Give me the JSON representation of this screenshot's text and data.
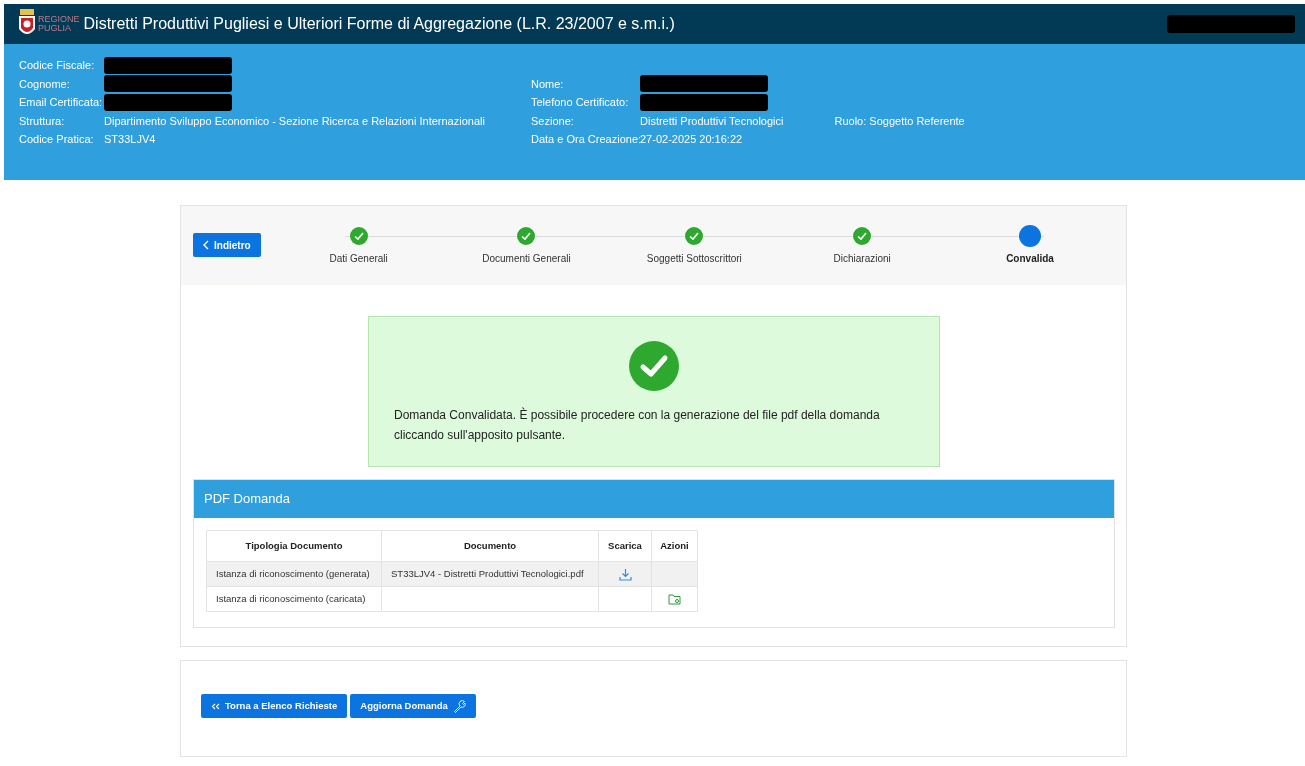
{
  "header": {
    "logo_text": [
      "REGIONE",
      "PUGLIA"
    ],
    "title": "Distretti Produttivi Pugliesi e Ulteriori Forme di Aggregazione (L.R. 23/2007 e s.m.i.)",
    "user_redacted": true
  },
  "info": {
    "left": [
      {
        "label": "Codice Fiscale:",
        "redacted": true
      },
      {
        "label": "Cognome:",
        "redacted": true
      },
      {
        "label": "Email Certificata:",
        "redacted": true
      },
      {
        "label": "Struttura:",
        "value": "Dipartimento Sviluppo Economico - Sezione Ricerca e Relazioni Internazionali"
      },
      {
        "label": "Codice Pratica:",
        "value": "ST33LJV4"
      }
    ],
    "right": [
      {
        "label": "Nome:",
        "redacted": true
      },
      {
        "label": "Telefono Certificato:",
        "redacted": true
      },
      {
        "label": "Sezione:",
        "value": "Distretti Produttivi Tecnologici",
        "extra": "Ruolo: Soggetto Referente"
      },
      {
        "label": "Data e Ora Creazione:",
        "value": "27-02-2025 20:16:22"
      }
    ]
  },
  "back_button": "Indietro",
  "steps": [
    {
      "label": "Dati Generali",
      "selected": false
    },
    {
      "label": "Documenti Generali",
      "selected": false
    },
    {
      "label": "Soggetti Sottoscrittori",
      "selected": false
    },
    {
      "label": "Dichiarazioni",
      "selected": false
    },
    {
      "label": "Convalida",
      "selected": true
    }
  ],
  "success_message": "Domanda Convalidata. È possibile procedere con la generazione del file pdf della domanda cliccando sull'apposito pulsante.",
  "pdf_panel": {
    "title": "PDF Domanda",
    "columns": [
      "Tipologia Documento",
      "Documento",
      "Scarica",
      "Azioni"
    ],
    "rows": [
      {
        "type": "Istanza di riconoscimento (generata)",
        "document": "ST33LJV4 - Distretti Produttivi Tecnologici.pdf",
        "download": true,
        "action": false
      },
      {
        "type": "Istanza di riconoscimento (caricata)",
        "document": "",
        "download": false,
        "action": true
      }
    ]
  },
  "footer_buttons": [
    {
      "label": "Torna a Elenco Richieste"
    },
    {
      "label": "Aggiorna Domanda"
    }
  ]
}
